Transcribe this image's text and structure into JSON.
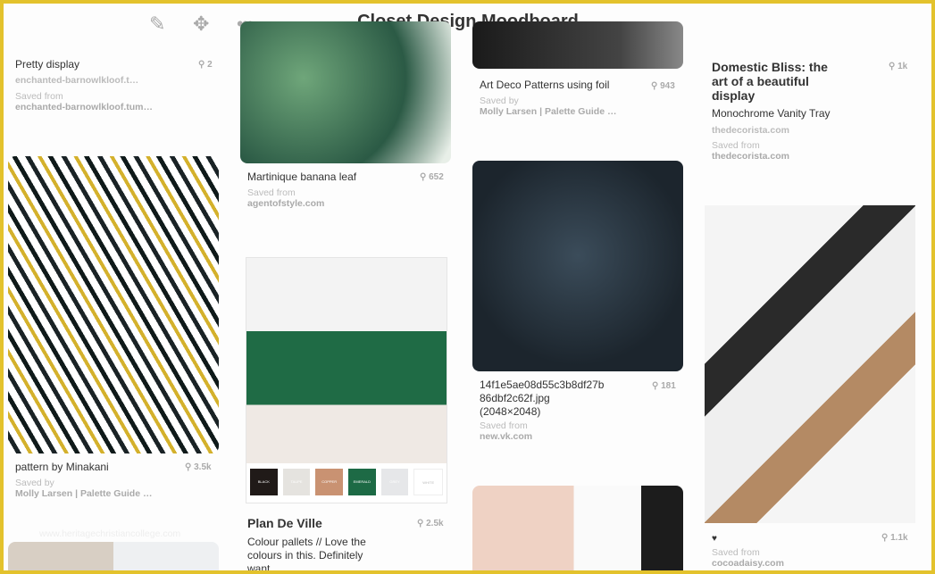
{
  "header": {
    "title": "Closet Design Moodboard",
    "icons": [
      "pencil-icon",
      "move-icon",
      "more-icon"
    ]
  },
  "colors": {
    "border": "#e3c22c"
  },
  "pins": [
    {
      "title": "Pretty display",
      "count": "2",
      "link": "enchanted-barnowlkloof.t…",
      "saved_label": "Saved from",
      "saved_source": "enchanted-barnowlkloof.tum…"
    },
    {
      "title": "pattern by Minakani",
      "count": "3.5k",
      "saved_label": "Saved by",
      "saved_source": "Molly Larsen | Palette Guide …"
    },
    {
      "title": "Martinique banana leaf",
      "count": "652",
      "saved_label": "Saved from",
      "saved_source": "agentofstyle.com"
    },
    {
      "title": "Plan De Ville",
      "count": "2.5k",
      "description": "Colour pallets // Love the colours in this. Definitely want…",
      "palette": [
        "BLACK",
        "TAUPE",
        "COPPER",
        "EMERALD",
        "GREY",
        "WHITE"
      ]
    },
    {
      "title": "Art Deco Patterns using foil",
      "count": "943",
      "saved_label": "Saved by",
      "saved_source": "Molly Larsen | Palette Guide …"
    },
    {
      "title": "14f1e5ae08d55c3b8df27b 86dbf2c62f.jpg (2048×2048)",
      "count": "181",
      "saved_label": "Saved from",
      "saved_source": "new.vk.com"
    },
    {
      "title": "Domestic Bliss: the art of a beautiful display",
      "count": "1k",
      "description": "Monochrome Vanity Tray",
      "link": "thedecorista.com",
      "saved_label": "Saved from",
      "saved_source": "thedecorista.com"
    },
    {
      "title": "♥",
      "count": "1.1k",
      "saved_label": "Saved from",
      "saved_source": "cocoadaisy.com"
    }
  ],
  "watermark": "www.heritagechristiancollege.com"
}
